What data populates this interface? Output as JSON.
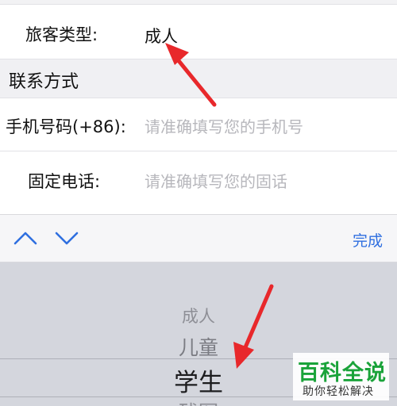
{
  "form": {
    "traveler_type": {
      "label": "旅客类型:",
      "value": "成人"
    },
    "contact_section_title": "联系方式",
    "mobile": {
      "label": "手机号码(+86):",
      "placeholder": "请准确填写您的手机号"
    },
    "landline": {
      "label": "固定电话:",
      "placeholder": "请准确填写您的固话"
    }
  },
  "toolbar": {
    "prev_icon": "chevron-up-icon",
    "next_icon": "chevron-down-icon",
    "done_label": "完成",
    "accent_color": "#2f6fe0"
  },
  "picker": {
    "options": [
      "成人",
      "儿童",
      "学生",
      "残军"
    ],
    "selected": "学生"
  },
  "annotations": {
    "arrow_color": "#e8282b"
  },
  "watermark": {
    "title": "百科全说",
    "subtitle": "助你轻松解决"
  }
}
